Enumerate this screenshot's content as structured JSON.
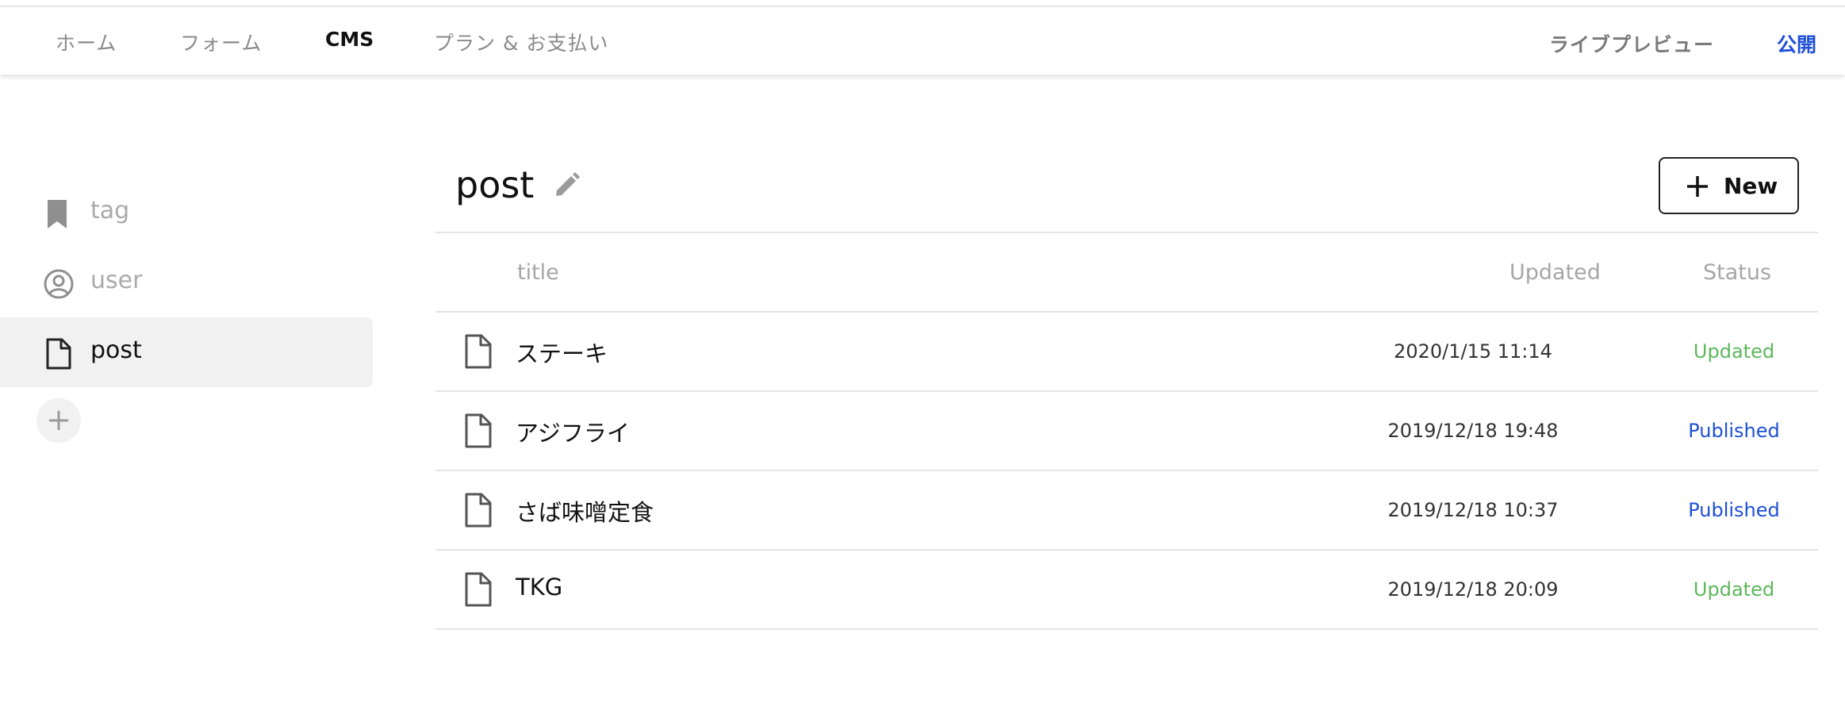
{
  "topbar": {
    "nav": [
      "ホーム",
      "フォーム",
      "CMS",
      "プラン & お支払い"
    ],
    "active": "CMS",
    "preview_label": "ライブプレビュー",
    "publish_label": "公開"
  },
  "sidebar": {
    "items": [
      {
        "label": "tag",
        "icon": "bookmark-icon"
      },
      {
        "label": "user",
        "icon": "user-circle-icon"
      },
      {
        "label": "post",
        "icon": "file-icon"
      }
    ],
    "active": "post",
    "add_icon": "plus-icon"
  },
  "main": {
    "title": "post",
    "new_label": "New",
    "columns": {
      "title": "title",
      "updated": "Updated",
      "status": "Status"
    },
    "rows": [
      {
        "title": "ステーキ",
        "updated": "2020/1/15 11:14",
        "status": "Updated"
      },
      {
        "title": "アジフライ",
        "updated": "2019/12/18 19:48",
        "status": "Published"
      },
      {
        "title": "さば味噌定食",
        "updated": "2019/12/18 10:37",
        "status": "Published"
      },
      {
        "title": "TKG",
        "updated": "2019/12/18 20:09",
        "status": "Updated"
      }
    ]
  },
  "colors": {
    "accent": "#1e4fd6",
    "updated_status": "#5cb85c",
    "published_status": "#1e4fd6"
  }
}
